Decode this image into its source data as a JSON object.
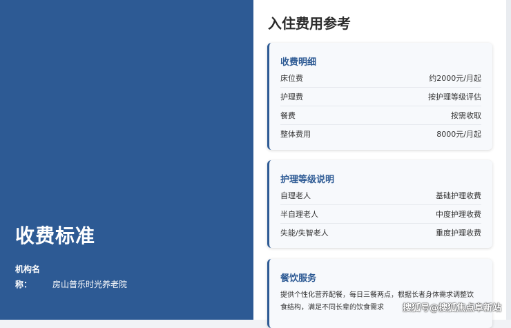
{
  "left_panel": {
    "title": "收费标准",
    "org_label_line1": "机构名",
    "org_label_line2": "称：",
    "org_name": "房山普乐时光养老院"
  },
  "main": {
    "title": "入住费用参考",
    "cards": [
      {
        "heading": "收费明细",
        "rows": [
          {
            "label": "床位费",
            "value": "约2000元/月起"
          },
          {
            "label": "护理费",
            "value": "按护理等级评估"
          },
          {
            "label": "餐费",
            "value": "按需收取"
          },
          {
            "label": "整体费用",
            "value": "8000元/月起"
          }
        ]
      },
      {
        "heading": "护理等级说明",
        "rows": [
          {
            "label": "自理老人",
            "value": "基础护理收费"
          },
          {
            "label": "半自理老人",
            "value": "中度护理收费"
          },
          {
            "label": "失能/失智老人",
            "value": "重度护理收费"
          }
        ]
      },
      {
        "heading": "餐饮服务",
        "description_line1": "提供个性化营养配餐，每日三餐两点，根据长者身体需求调整饮",
        "description_line2": "食结构，满足不同长辈的饮食需求"
      }
    ]
  },
  "watermark": "搜狐号@搜狐焦点阜新站",
  "colors": {
    "accent": "#2d5a94",
    "panel_bg": "#2d5a94",
    "card_bg": "#f7f9fc"
  }
}
